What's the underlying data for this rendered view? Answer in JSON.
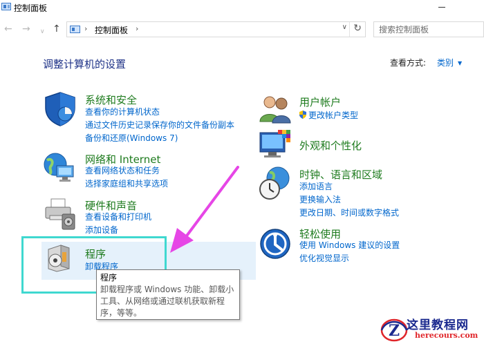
{
  "window": {
    "title": "控制面板"
  },
  "address": {
    "path_item": "控制面板"
  },
  "search": {
    "placeholder": "搜索控制面板"
  },
  "header": {
    "title": "调整计算机的设置",
    "view_by_label": "查看方式:",
    "view_by_value": "类别"
  },
  "categories": {
    "system_security": {
      "title": "系统和安全",
      "links": [
        "查看你的计算机状态",
        "通过文件历史记录保存你的文件备份副本",
        "备份和还原(Windows 7)"
      ]
    },
    "network": {
      "title": "网络和 Internet",
      "links": [
        "查看网络状态和任务",
        "选择家庭组和共享选项"
      ]
    },
    "hardware": {
      "title": "硬件和声音",
      "links": [
        "查看设备和打印机",
        "添加设备"
      ]
    },
    "programs": {
      "title": "程序",
      "links": [
        "卸载程序"
      ]
    },
    "user_accounts": {
      "title": "用户帐户",
      "links": [
        "更改帐户类型"
      ]
    },
    "appearance": {
      "title": "外观和个性化",
      "links": []
    },
    "clock_region": {
      "title": "时钟、语言和区域",
      "links": [
        "添加语言",
        "更换输入法",
        "更改日期、时间或数字格式"
      ]
    },
    "ease_of_access": {
      "title": "轻松使用",
      "links": [
        "使用 Windows 建议的设置",
        "优化视觉显示"
      ]
    }
  },
  "tooltip": {
    "title": "程序",
    "lines": [
      "卸载程序或 Windows 功能、卸载小",
      "工具、从网络或通过联机获取新程",
      "序，等等。"
    ]
  },
  "watermark": {
    "title": "这里教程网",
    "url": "herecours.com",
    "logo_letter": "Z"
  },
  "icons": [
    "app-icon",
    "back-arrow-icon",
    "forward-arrow-icon",
    "recent-dropdown-icon",
    "up-arrow-icon",
    "refresh-icon",
    "shield-icon",
    "network-globe-icon",
    "printer-icon",
    "program-disc-icon",
    "users-icon",
    "display-palette-icon",
    "clock-globe-icon",
    "ease-of-access-icon",
    "uac-shield-icon",
    "annotation-arrow-icon"
  ],
  "colors": {
    "link": "#0066cc",
    "category_title": "#1e7b1e",
    "page_title": "#1e3287",
    "highlight_border": "#3fd8d0",
    "annotation_arrow": "#e646e6"
  }
}
